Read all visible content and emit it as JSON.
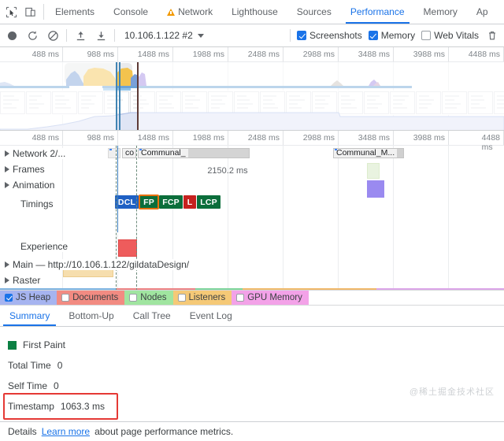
{
  "tabbar": {
    "icons": [
      {
        "name": "inspect-element-icon"
      },
      {
        "name": "device-toolbar-icon"
      }
    ],
    "tabs": [
      {
        "label": "Elements",
        "active": false,
        "warning": false
      },
      {
        "label": "Console",
        "active": false,
        "warning": false
      },
      {
        "label": "Network",
        "active": false,
        "warning": true
      },
      {
        "label": "Lighthouse",
        "active": false,
        "warning": false
      },
      {
        "label": "Sources",
        "active": false,
        "warning": false
      },
      {
        "label": "Performance",
        "active": true,
        "warning": false
      },
      {
        "label": "Memory",
        "active": false,
        "warning": false
      },
      {
        "label": "Ap",
        "active": false,
        "warning": false
      }
    ]
  },
  "toolbar": {
    "record_title": "record-button",
    "reload_title": "reload-and-record-button",
    "clear_title": "clear-button",
    "upload_title": "load-profile-button",
    "download_title": "save-profile-button",
    "session_name": "10.106.1.122 #2",
    "checkboxes": [
      {
        "label": "Screenshots",
        "checked": true
      },
      {
        "label": "Memory",
        "checked": true
      },
      {
        "label": "Web Vitals",
        "checked": false
      }
    ],
    "trash_title": "collect-garbage-button"
  },
  "overview": {
    "ruler_ticks": [
      "488 ms",
      "988 ms",
      "1488 ms",
      "1988 ms",
      "2488 ms",
      "2988 ms",
      "3488 ms",
      "3988 ms",
      "4488 ms"
    ]
  },
  "flame": {
    "ruler_ticks": [
      "488 ms",
      "988 ms",
      "1488 ms",
      "1988 ms",
      "2488 ms",
      "2988 ms",
      "3488 ms",
      "3988 ms",
      "4488 ms"
    ],
    "tracks": [
      {
        "label": "Network 2/...",
        "expandable": true
      },
      {
        "label": "Frames",
        "expandable": true
      },
      {
        "label": "Animation",
        "expandable": true
      },
      {
        "label": "Timings",
        "expandable": false
      },
      {
        "label": "Experience",
        "expandable": false
      },
      {
        "label": "Main — http://10.106.1.122/gildataDesign/",
        "expandable": true
      },
      {
        "label": "Raster",
        "expandable": true
      }
    ],
    "network_requests": [
      {
        "label": "co"
      },
      {
        "label": "Communal_"
      },
      {
        "label": "Communal_M..."
      }
    ],
    "frame_label": "2150.2 ms",
    "timing_markers": [
      {
        "label": "DCL",
        "color": "#1e60c4",
        "selected": false
      },
      {
        "label": "FP",
        "color": "#0b6e3b",
        "selected": true
      },
      {
        "label": "FCP",
        "color": "#0b6e3b",
        "selected": false
      },
      {
        "label": "L",
        "color": "#c5221f",
        "selected": false
      },
      {
        "label": "LCP",
        "color": "#0b6e3b",
        "selected": false
      }
    ]
  },
  "memory_legend": [
    {
      "label": "JS Heap",
      "checked": true,
      "color": "#a6b4f0"
    },
    {
      "label": "Documents",
      "checked": false,
      "color": "#f28b82"
    },
    {
      "label": "Nodes",
      "checked": false,
      "color": "#a0e5a0"
    },
    {
      "label": "Listeners",
      "checked": false,
      "color": "#f5c977"
    },
    {
      "label": "GPU Memory",
      "checked": false,
      "color": "#f3a2e8"
    }
  ],
  "bottom_tabs": [
    {
      "label": "Summary",
      "active": true
    },
    {
      "label": "Bottom-Up",
      "active": false
    },
    {
      "label": "Call Tree",
      "active": false
    },
    {
      "label": "Event Log",
      "active": false
    }
  ],
  "details": {
    "event_name": "First Paint",
    "event_color": "#0b8043",
    "rows": [
      {
        "key": "Total Time",
        "value": "0"
      },
      {
        "key": "Self Time",
        "value": "0"
      },
      {
        "key": "Timestamp",
        "value": "1063.3 ms"
      }
    ],
    "highlight_color": "#e53935"
  },
  "footer": {
    "label": "Details",
    "link": "Learn more",
    "suffix": "about page performance metrics."
  },
  "watermark": "@稀土掘金技术社区"
}
